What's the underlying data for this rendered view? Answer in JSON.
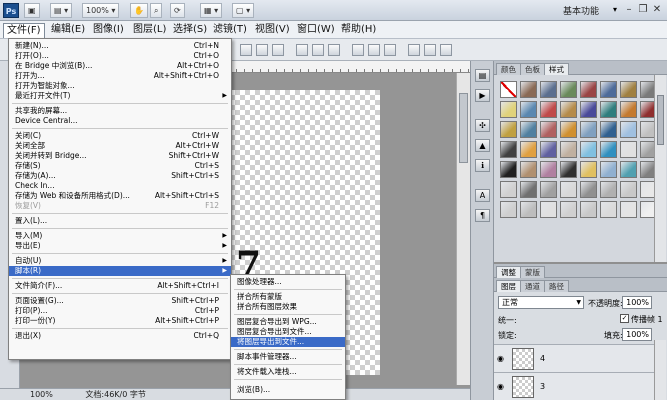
{
  "app": {
    "logo": "Ps",
    "zoom": "100%",
    "workspace": "基本功能"
  },
  "menubar": [
    "文件(F)",
    "编辑(E)",
    "图像(I)",
    "图层(L)",
    "选择(S)",
    "滤镜(T)",
    "视图(V)",
    "窗口(W)",
    "帮助(H)"
  ],
  "file_menu": {
    "items": [
      {
        "label": "新建(N)...",
        "shortcut": "Ctrl+N"
      },
      {
        "label": "打开(O)...",
        "shortcut": "Ctrl+O"
      },
      {
        "label": "在 Bridge 中浏览(B)...",
        "shortcut": "Alt+Ctrl+O"
      },
      {
        "label": "打开为...",
        "shortcut": "Alt+Shift+Ctrl+O"
      },
      {
        "label": "打开为智能对象..."
      },
      {
        "label": "最近打开文件(T)"
      },
      {
        "label": "共享我的屏幕..."
      },
      {
        "label": "Device Central..."
      },
      {
        "label": "关闭(C)",
        "shortcut": "Ctrl+W"
      },
      {
        "label": "关闭全部",
        "shortcut": "Alt+Ctrl+W"
      },
      {
        "label": "关闭并转到 Bridge...",
        "shortcut": "Shift+Ctrl+W"
      },
      {
        "label": "存储(S)",
        "shortcut": "Ctrl+S"
      },
      {
        "label": "存储为(A)...",
        "shortcut": "Shift+Ctrl+S"
      },
      {
        "label": "Check In..."
      },
      {
        "label": "存储为 Web 和设备所用格式(D)...",
        "shortcut": "Alt+Shift+Ctrl+S"
      },
      {
        "label": "恢复(V)",
        "shortcut": "F12"
      },
      {
        "label": "置入(L)..."
      },
      {
        "label": "导入(M)"
      },
      {
        "label": "导出(E)"
      },
      {
        "label": "自动(U)"
      },
      {
        "label": "脚本(R)"
      },
      {
        "label": "文件简介(F)...",
        "shortcut": "Alt+Shift+Ctrl+I"
      },
      {
        "label": "页面设置(G)...",
        "shortcut": "Shift+Ctrl+P"
      },
      {
        "label": "打印(P)...",
        "shortcut": "Ctrl+P"
      },
      {
        "label": "打印一份(Y)",
        "shortcut": "Alt+Shift+Ctrl+P"
      },
      {
        "label": "退出(X)",
        "shortcut": "Ctrl+Q"
      }
    ]
  },
  "scripts_submenu": [
    "图像处理器...",
    "拼合所有蒙版",
    "拼合所有图层效果",
    "图层复合导出到 WPG...",
    "图层复合导出到文件...",
    "将图层导出到文件...",
    "脚本事件管理器...",
    "将文件载入堆栈...",
    "浏览(B)..."
  ],
  "styles_panel": {
    "tabs": [
      "颜色",
      "色板",
      "样式"
    ],
    "swatch_colors": [
      "#ffffff",
      "#8a6a55",
      "#5b6f8f",
      "#6a8a5b",
      "#9a4444",
      "#4d6b9a",
      "#a08040",
      "#7a7a7a",
      "#e0d27a",
      "#5a88b0",
      "#c04a4a",
      "#b58b4a",
      "#4a4a9a",
      "#2f7e7e",
      "#c47a2f",
      "#8f2f2f",
      "#c0a040",
      "#5080a0",
      "#b06060",
      "#d09030",
      "#80a0c0",
      "#306090",
      "#a0c0e0",
      "#c0c0c0",
      "#404040",
      "#e0a040",
      "#6060a0",
      "#c0b0a0",
      "#80c0e0",
      "#3090c0",
      "#e0e0e0",
      "#a0a0a0",
      "#202020",
      "#b09070",
      "#b080a0",
      "#303030",
      "#e0c060",
      "#90b0d0",
      "#50a0b0",
      "#808080",
      "#d0d0d0",
      "#707070",
      "#a0a0a0",
      "#d8d8d8",
      "#909090",
      "#b0b0b0",
      "#c8c8c8",
      "#e8e8e8",
      "#cfcfcf",
      "#bdbdbd",
      "#e0e0e0",
      "#d0d0d0",
      "#c8c8c8",
      "#dadada",
      "#e4e4e4",
      "#f0f0f0"
    ]
  },
  "adj_tabs": [
    "调整",
    "蒙版"
  ],
  "layers_panel": {
    "tabs": [
      "图层",
      "通道",
      "路径"
    ],
    "blend_mode": "正常",
    "opacity_label": "不透明度:",
    "opacity": "100%",
    "unify_label": "统一:",
    "propagate_label": "传播帧 1",
    "lock_label": "锁定:",
    "fill_label": "填充:",
    "fill": "100%",
    "layers": [
      {
        "name": "4"
      },
      {
        "name": "3"
      }
    ]
  },
  "status": {
    "zoom": "100%",
    "doc": "文档:46K/0 字节"
  },
  "canvas_glyph": "7"
}
